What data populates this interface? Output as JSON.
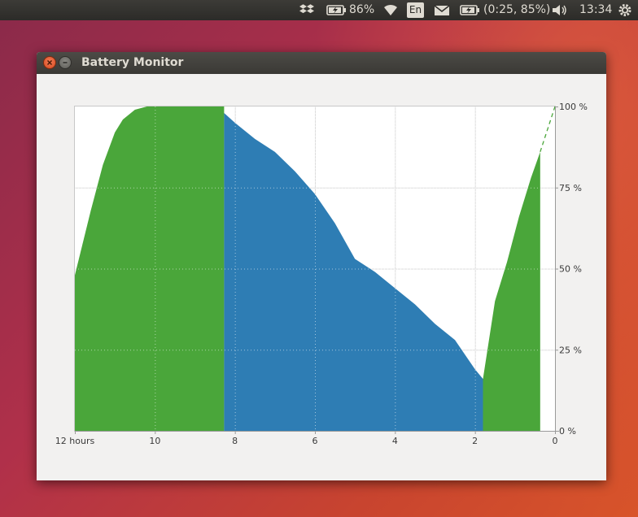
{
  "topbar": {
    "battery_percent": "86%",
    "language": "En",
    "battery_status": "(0:25, 85%)",
    "clock": "13:34",
    "icons": [
      "dropbox-icon",
      "battery-icon",
      "wifi-icon",
      "keyboard-lang-icon",
      "mail-icon",
      "battery-status-icon",
      "volume-icon",
      "gear-icon"
    ]
  },
  "window": {
    "title": "Battery Monitor"
  },
  "colors": {
    "charging": "#4aa63a",
    "discharging": "#2e7db4",
    "grid": "#dddddd",
    "projection": "#4aa63a"
  },
  "chart_data": {
    "type": "area",
    "title": "",
    "xlabel": "",
    "ylabel": "",
    "x_reversed": true,
    "xlim": [
      12,
      0
    ],
    "ylim": [
      0,
      100
    ],
    "x_ticks": [
      12,
      10,
      8,
      6,
      4,
      2,
      0
    ],
    "x_tick_labels": [
      "12 hours",
      "10",
      "8",
      "6",
      "4",
      "2",
      "0"
    ],
    "y_ticks": [
      0,
      25,
      50,
      75,
      100
    ],
    "y_tick_labels": [
      "0 %",
      "25 %",
      "50 %",
      "75 %",
      "100 %"
    ],
    "y_axis_position": "right",
    "grid": true,
    "series": [
      {
        "state": "charging",
        "color": "#4aa63a",
        "x": [
          12,
          11.6,
          11.3,
          11.0,
          10.8,
          10.5,
          10.2,
          10.0,
          9.5,
          9.0,
          8.5,
          8.27
        ],
        "y": [
          48,
          68,
          82,
          92,
          96,
          99,
          100,
          100,
          100,
          100,
          100,
          100
        ]
      },
      {
        "state": "discharging",
        "color": "#2e7db4",
        "x": [
          8.27,
          8.0,
          7.5,
          7.0,
          6.5,
          6.0,
          5.5,
          5.0,
          4.5,
          4.0,
          3.5,
          3.0,
          2.5,
          2.0,
          1.8
        ],
        "y": [
          98,
          95,
          90,
          86,
          80,
          73,
          64,
          53,
          49,
          44,
          39,
          33,
          28,
          19,
          16
        ]
      },
      {
        "state": "charging",
        "color": "#4aa63a",
        "x": [
          1.8,
          1.5,
          1.2,
          0.9,
          0.6,
          0.37
        ],
        "y": [
          16,
          40,
          52,
          66,
          78,
          86
        ]
      }
    ],
    "projection": {
      "style": "dashed",
      "color": "#4aa63a",
      "x": [
        0.37,
        0
      ],
      "y": [
        86,
        100
      ]
    }
  }
}
